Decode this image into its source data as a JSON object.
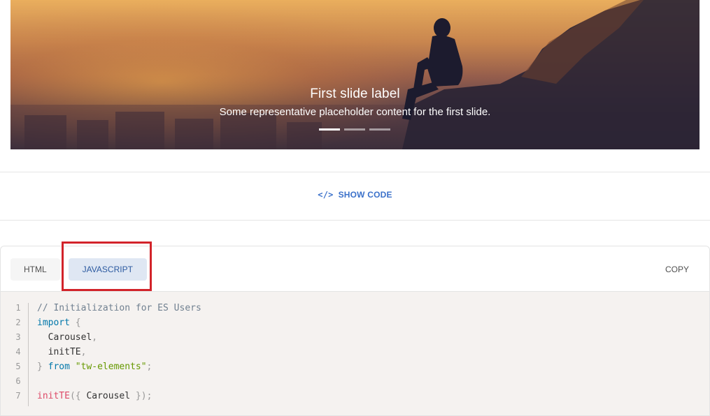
{
  "carousel": {
    "caption_title": "First slide label",
    "caption_text": "Some representative placeholder content for the first slide.",
    "indicators": [
      {
        "label": "Slide 1",
        "active": true
      },
      {
        "label": "Slide 2",
        "active": false
      },
      {
        "label": "Slide 3",
        "active": false
      }
    ]
  },
  "toolbar": {
    "show_code_label": "SHOW CODE",
    "show_code_icon": "</>"
  },
  "code_panel": {
    "tabs": [
      {
        "label": "HTML",
        "active": false
      },
      {
        "label": "JAVASCRIPT",
        "active": true
      }
    ],
    "copy_label": "COPY",
    "lines": [
      {
        "n": "1",
        "tokens": [
          {
            "t": "// Initialization for ES Users",
            "k": "comment"
          }
        ]
      },
      {
        "n": "2",
        "tokens": [
          {
            "t": "import",
            "k": "kw"
          },
          {
            "t": " ",
            "k": ""
          },
          {
            "t": "{",
            "k": "punc"
          }
        ]
      },
      {
        "n": "3",
        "tokens": [
          {
            "t": "  Carousel",
            "k": ""
          },
          {
            "t": ",",
            "k": "punc"
          }
        ]
      },
      {
        "n": "4",
        "tokens": [
          {
            "t": "  initTE",
            "k": ""
          },
          {
            "t": ",",
            "k": "punc"
          }
        ]
      },
      {
        "n": "5",
        "tokens": [
          {
            "t": "}",
            "k": "punc"
          },
          {
            "t": " ",
            "k": ""
          },
          {
            "t": "from",
            "k": "kw"
          },
          {
            "t": " ",
            "k": ""
          },
          {
            "t": "\"tw-elements\"",
            "k": "str"
          },
          {
            "t": ";",
            "k": "punc"
          }
        ]
      },
      {
        "n": "6",
        "tokens": []
      },
      {
        "n": "7",
        "tokens": [
          {
            "t": "initTE",
            "k": "fn"
          },
          {
            "t": "(",
            "k": "punc"
          },
          {
            "t": "{",
            "k": "punc"
          },
          {
            "t": " Carousel ",
            "k": ""
          },
          {
            "t": "}",
            "k": "punc"
          },
          {
            "t": ")",
            "k": "punc"
          },
          {
            "t": ";",
            "k": "punc"
          }
        ]
      }
    ]
  },
  "colors": {
    "accent": "#3b71ca",
    "highlight_border": "#d2232a",
    "code_bg": "#f5f2f0"
  }
}
